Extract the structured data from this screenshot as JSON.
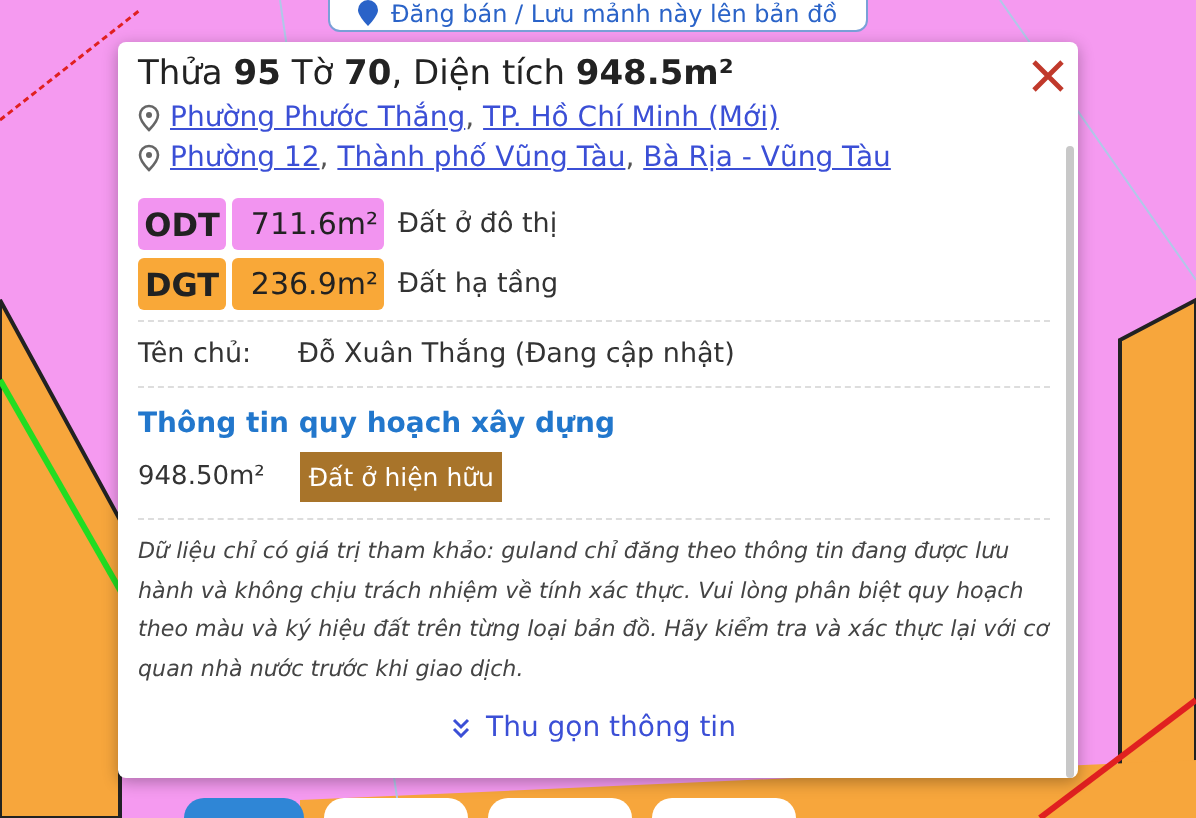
{
  "top_button": {
    "label": "Đăng bán / Lưu mảnh này lên bản đồ"
  },
  "title": "Thửa **95** Tờ **70**, Diện tích **948.5m²**",
  "addresses": [
    {
      "links": [
        "Phường Phước Thắng",
        "TP. Hồ Chí Minh (Mới)"
      ],
      "separator": ","
    },
    {
      "links": [
        "Phường 12",
        "Thành phố Vũng Tàu",
        "Bà Rịa - Vũng Tàu"
      ],
      "separator": ","
    }
  ],
  "land_uses": [
    {
      "code": "ODT",
      "area": "711.6m²",
      "label": "Đất ở đô thị",
      "color": "#f294f0"
    },
    {
      "code": "DGT",
      "area": "236.9m²",
      "label": "Đất hạ tầng",
      "color": "#f9a838"
    }
  ],
  "owner": {
    "label": "Tên chủ:",
    "value": "Đỗ Xuân Thắng (Đang cập nhật)"
  },
  "planning": {
    "heading": "Thông tin quy hoạch xây dựng",
    "area": "948.50m²",
    "tag": "Đất ở hiện hữu"
  },
  "disclaimer": "Dữ liệu chỉ có giá trị tham khảo: guland chỉ đăng theo thông tin đang được lưu hành và không chịu trách nhiệm về tính xác thực. Vui lòng phân biệt quy hoạch theo màu và ký hiệu đất trên từng loại bản đồ. Hãy kiểm tra và xác thực lại với cơ quan nhà nước trước khi giao dịch.",
  "collapse_link": "Thu gọn thông tin"
}
